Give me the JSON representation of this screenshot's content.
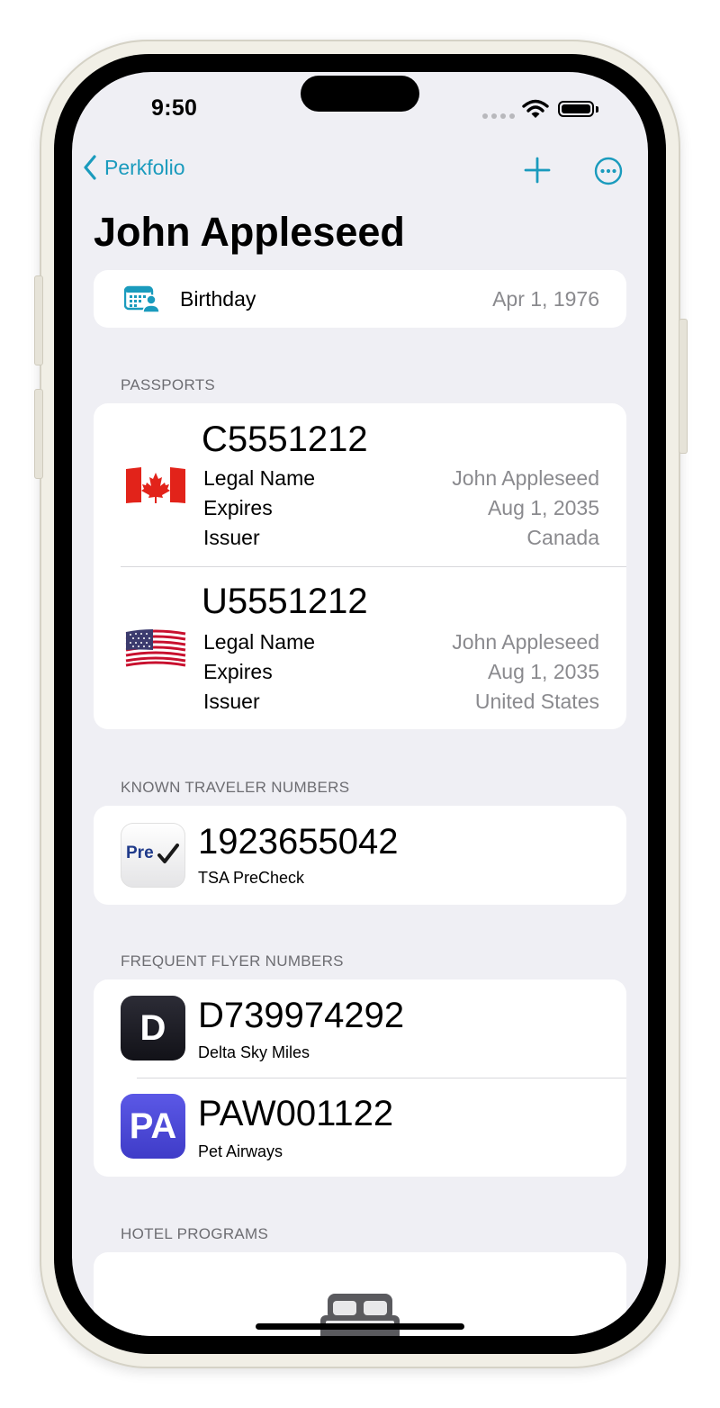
{
  "status_bar": {
    "time": "9:50"
  },
  "nav": {
    "back_label": "Perkfolio"
  },
  "page": {
    "title": "John Appleseed"
  },
  "birthday": {
    "label": "Birthday",
    "value": "Apr 1, 1976"
  },
  "passports": {
    "header": "PASSPORTS",
    "items": [
      {
        "number": "C5551212",
        "flag": "canada-flag",
        "legal_name_label": "Legal Name",
        "legal_name": "John Appleseed",
        "expires_label": "Expires",
        "expires": "Aug 1, 2035",
        "issuer_label": "Issuer",
        "issuer": "Canada"
      },
      {
        "number": "U5551212",
        "flag": "usa-flag",
        "legal_name_label": "Legal Name",
        "legal_name": "John Appleseed",
        "expires_label": "Expires",
        "expires": "Aug 1, 2035",
        "issuer_label": "Issuer",
        "issuer": "United States"
      }
    ]
  },
  "known_traveler": {
    "header": "KNOWN TRAVELER NUMBERS",
    "items": [
      {
        "number": "1923655042",
        "program": "TSA PreCheck",
        "icon_text": "Pre"
      }
    ]
  },
  "frequent_flyer": {
    "header": "FREQUENT FLYER NUMBERS",
    "items": [
      {
        "number": "D739974292",
        "program": "Delta Sky Miles",
        "icon_text": "D"
      },
      {
        "number": "PAW001122",
        "program": "Pet Airways",
        "icon_text": "PA"
      }
    ]
  },
  "hotel_programs": {
    "header": "HOTEL PROGRAMS"
  },
  "colors": {
    "accent": "#1a9bbd",
    "background": "#efeff4",
    "secondary_text": "#8a8a8e",
    "pet_airways": "#4b47d8",
    "delta": "#1c1c24"
  }
}
